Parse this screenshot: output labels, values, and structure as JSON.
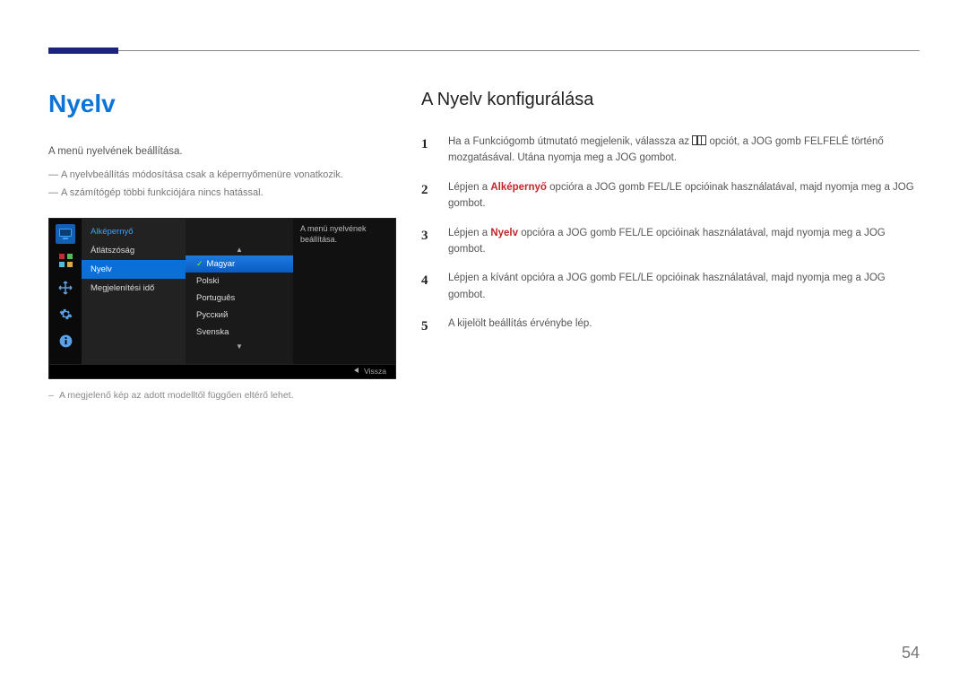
{
  "header": {},
  "left": {
    "title": "Nyelv",
    "intro": "A menü nyelvének beállítása.",
    "note1": "A nyelvbeállítás módosítása csak a képernyőmenüre vonatkozik.",
    "note2": "A számítógép többi funkciójára nincs hatással.",
    "caption": "A megjelenő kép az adott modelltől függően eltérő lehet."
  },
  "osd": {
    "category": "Alképernyő",
    "menu": {
      "item0": "Átlátszóság",
      "item1": "Nyelv",
      "item2": "Megjelenítési idő"
    },
    "options": {
      "opt0": "Magyar",
      "opt1": "Polski",
      "opt2": "Português",
      "opt3": "Русский",
      "opt4": "Svenska"
    },
    "desc": "A menü nyelvének beállítása.",
    "back": "Vissza",
    "icons": {
      "monitor": "monitor-icon",
      "corners": "pip-icon",
      "arrows": "position-icon",
      "gear": "gear-icon",
      "info": "info-icon"
    }
  },
  "right": {
    "title": "A Nyelv konfigurálása",
    "steps": {
      "s1a": "Ha a Funkciógomb útmutató megjelenik, válassza az ",
      "s1b": " opciót, a JOG gomb FELFELÉ történő mozgatásával. Utána nyomja meg a JOG gombot.",
      "s2a": "Lépjen a ",
      "s2a_strong": "Alképernyő",
      "s2b": " opcióra a JOG gomb FEL/LE opcióinak használatával, majd nyomja meg a JOG gombot.",
      "s3a": "Lépjen a ",
      "s3a_strong": "Nyelv",
      "s3b": " opcióra a JOG gomb FEL/LE opcióinak használatával, majd nyomja meg a JOG gombot.",
      "s4": "Lépjen a kívánt opcióra a JOG gomb FEL/LE opcióinak használatával, majd nyomja meg a JOG gombot.",
      "s5": "A kijelölt beállítás érvénybe lép."
    }
  },
  "page_number": "54"
}
